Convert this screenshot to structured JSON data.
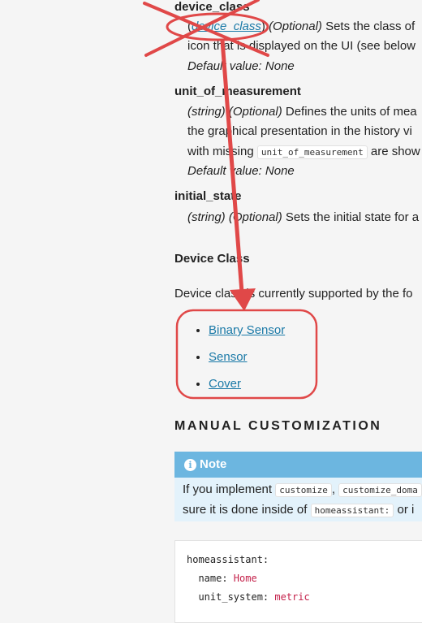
{
  "attributes": [
    {
      "name": "device_class",
      "type_link": "device_class",
      "optional": "(Optional)",
      "desc1": " Sets the class of",
      "desc2": "icon that is displayed on the UI (see below",
      "default": "Default value: None"
    },
    {
      "name": "unit_of_measurement",
      "type": "(string)",
      "optional": "(Optional)",
      "desc1": " Defines the units of mea",
      "desc2": "the graphical presentation in the history vi",
      "desc3_pre": "with missing ",
      "desc3_code": "unit_of_measurement",
      "desc3_post": " are show",
      "default": "Default value: None"
    },
    {
      "name": "initial_state",
      "type": "(string)",
      "optional": "(Optional)",
      "desc1": " Sets the initial state for a"
    }
  ],
  "device_class_section": {
    "heading": "Device Class",
    "intro": "Device class is currently supported by the fo",
    "links": [
      "Binary Sensor",
      "Sensor",
      "Cover"
    ]
  },
  "manual_customization": {
    "heading": "MANUAL CUSTOMIZATION",
    "note_icon": "info-icon",
    "note_title": "Note",
    "line1_pre": "If you implement ",
    "line1_code1": "customize",
    "line1_mid": ", ",
    "line1_code2": "customize_doma",
    "line2_pre": "sure it is done inside of ",
    "line2_code": "homeassistant:",
    "line2_post": " or i"
  },
  "code_block": {
    "line1_key": "homeassistant:",
    "line2_key": "  name: ",
    "line2_val": "Home",
    "line3_key": "  unit_system: ",
    "line3_val": "metric"
  },
  "annotation_color": "#e04848"
}
